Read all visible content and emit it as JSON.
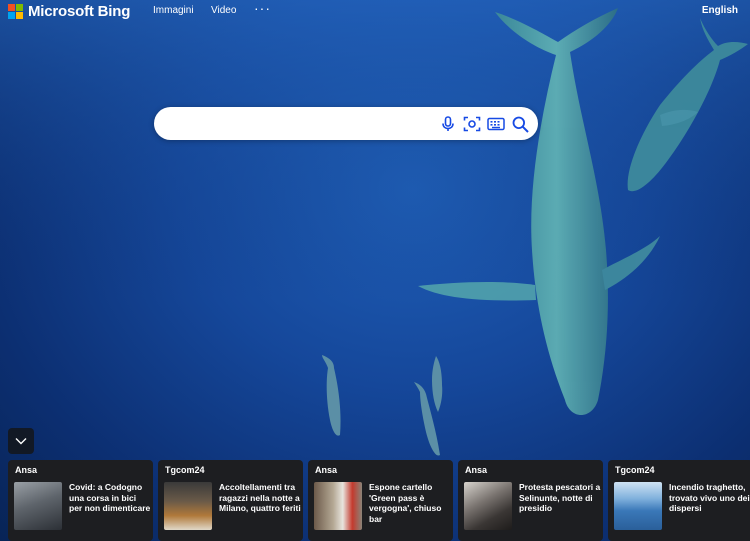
{
  "header": {
    "brand": "Microsoft Bing",
    "nav": [
      "Immagini",
      "Video"
    ],
    "more": "···",
    "language": "English"
  },
  "search": {
    "value": "",
    "placeholder": "",
    "icons": [
      "microphone-icon",
      "visual-search-icon",
      "keyboard-icon",
      "search-icon"
    ]
  },
  "news": [
    {
      "source": "Ansa",
      "title": "Covid: a Codogno una corsa in bici per non dimenticare"
    },
    {
      "source": "Tgcom24",
      "title": "Accoltellamenti tra ragazzi nella notte a Milano, quattro feriti"
    },
    {
      "source": "Ansa",
      "title": "Espone cartello 'Green pass è vergogna', chiuso bar"
    },
    {
      "source": "Ansa",
      "title": "Protesta pescatori a Selinunte, notte di presidio"
    },
    {
      "source": "Tgcom24",
      "title": "Incendio traghetto, trovato vivo uno dei dispersi"
    }
  ],
  "colors": {
    "ms_red": "#f25022",
    "ms_green": "#7fba00",
    "ms_blue": "#00a4ef",
    "ms_yellow": "#ffb900",
    "ocean": "#15479a",
    "card_bg": "#1d1e21",
    "icon_blue": "#174ae4"
  }
}
